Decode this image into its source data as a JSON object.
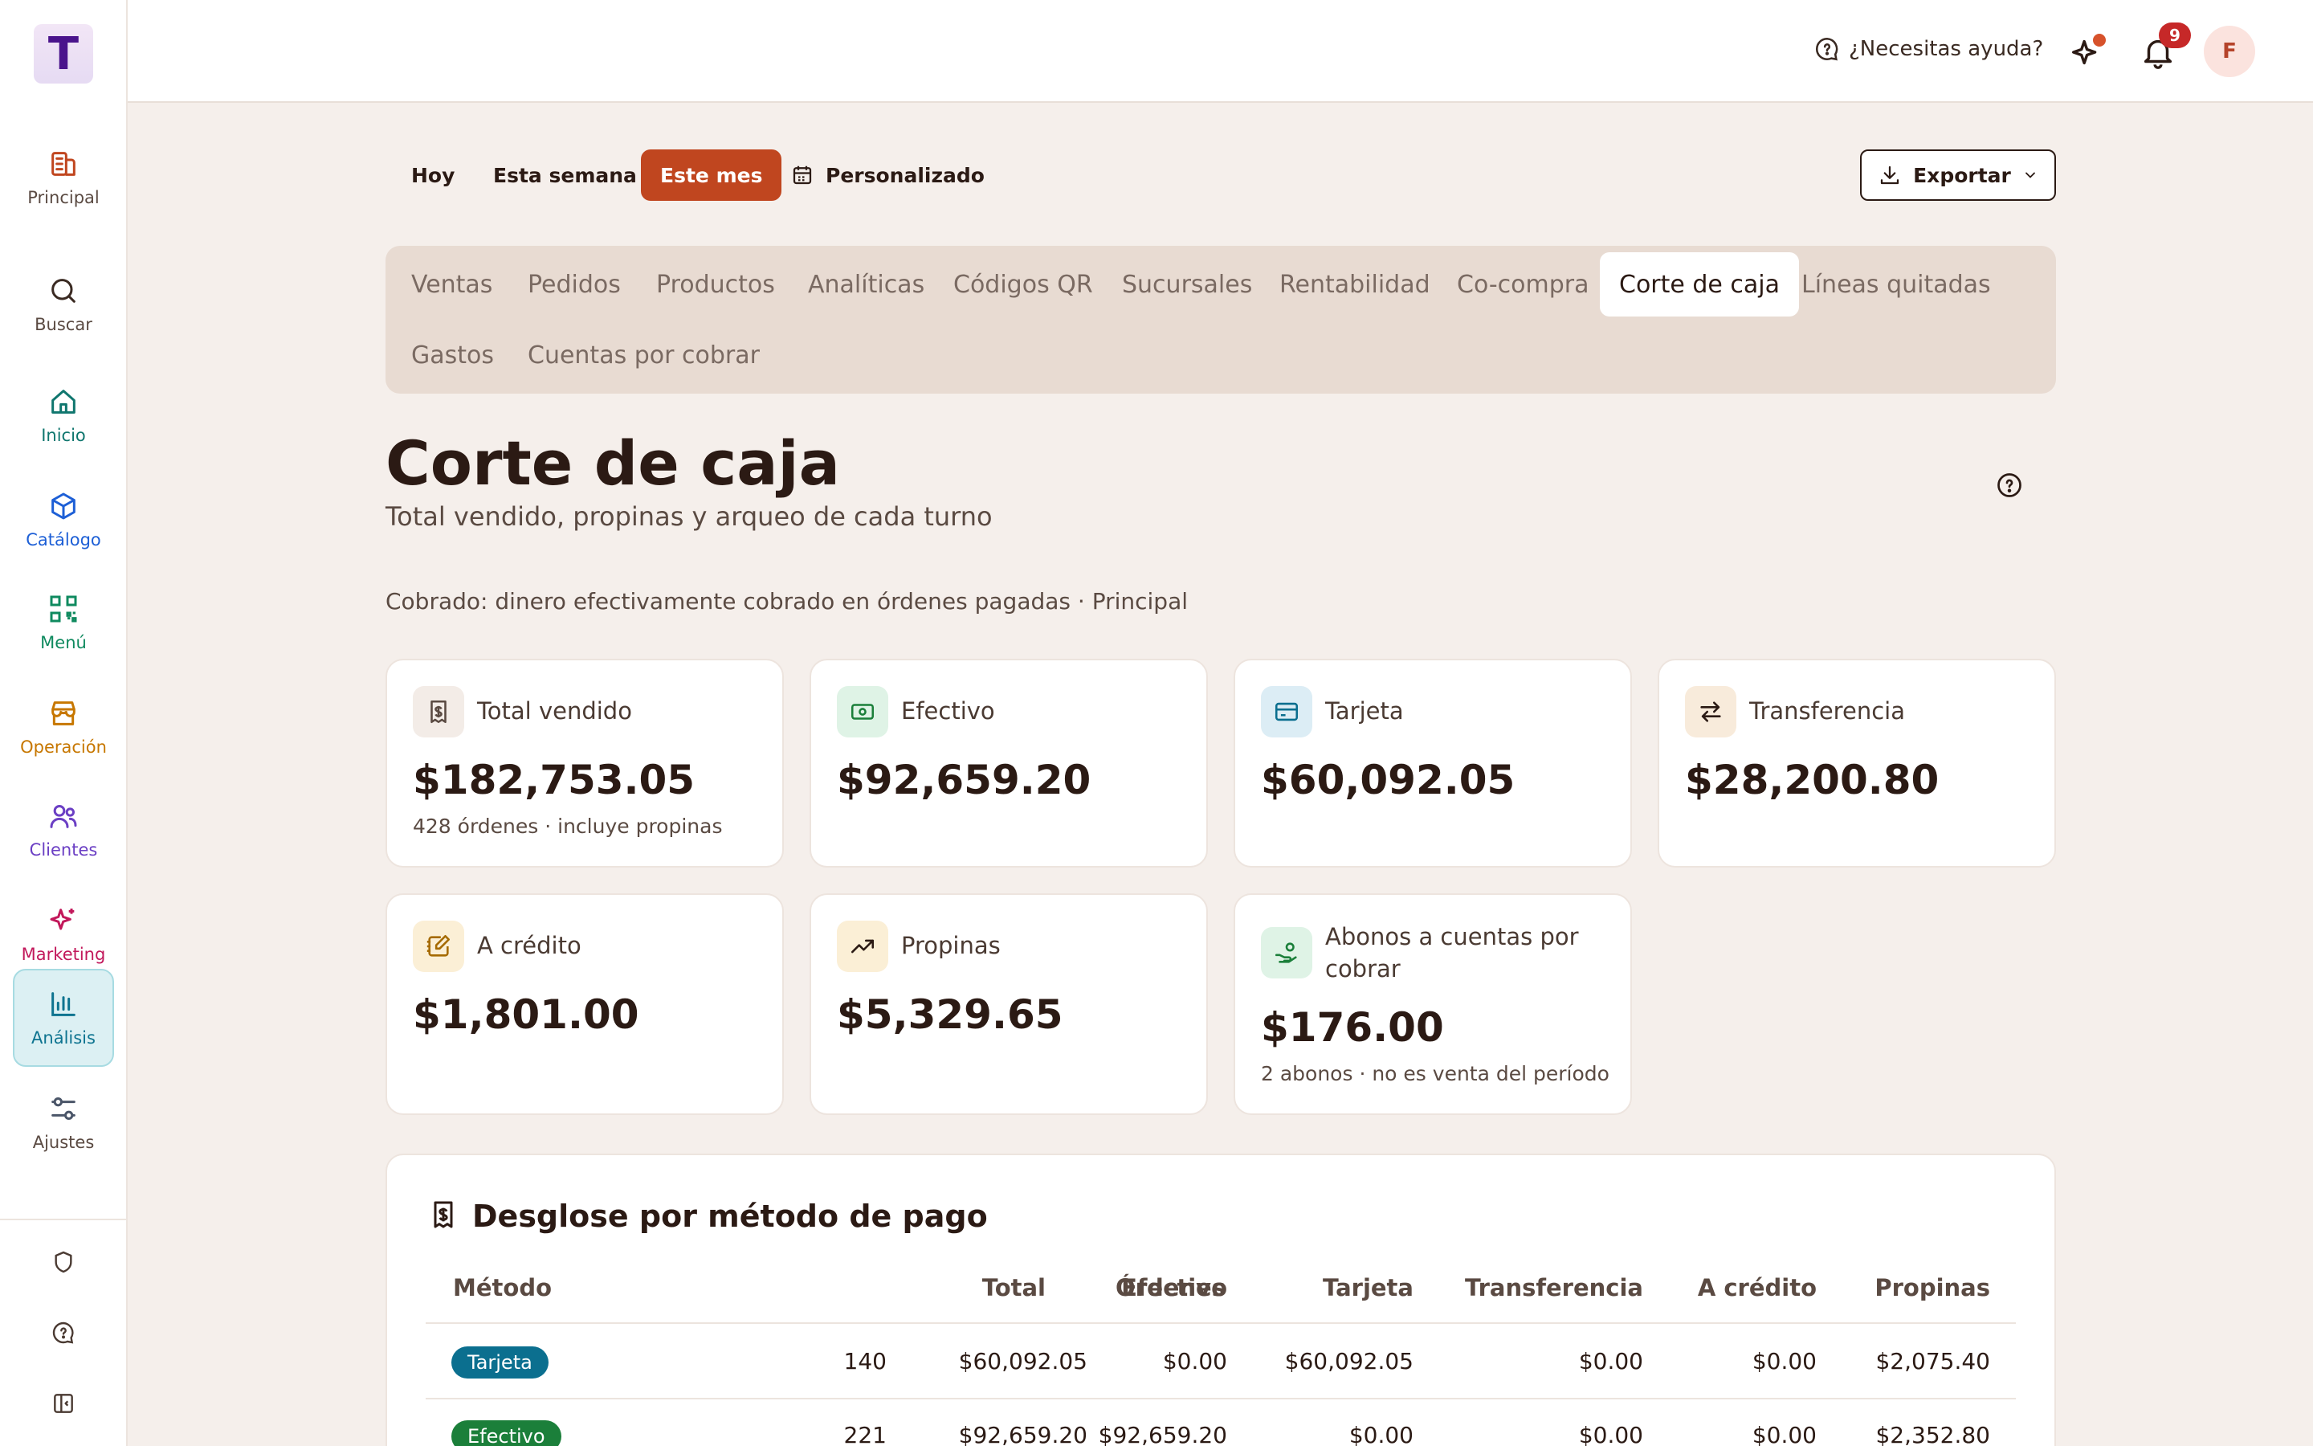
{
  "app": {
    "logo_letter": "T",
    "nav": [
      {
        "label": "Principal",
        "icon": "building-icon",
        "color": "#c0461f"
      },
      {
        "label": "Buscar",
        "icon": "search-icon",
        "color": "#3a2a22"
      },
      {
        "label": "Inicio",
        "icon": "home-icon",
        "color": "#0f766e"
      },
      {
        "label": "Catálogo",
        "icon": "box-icon",
        "color": "#1d5fd6"
      },
      {
        "label": "Menú",
        "icon": "qr-icon",
        "color": "#0f8a5f"
      },
      {
        "label": "Operación",
        "icon": "store-icon",
        "color": "#c77700"
      },
      {
        "label": "Clientes",
        "icon": "users-icon",
        "color": "#6b3fc4"
      },
      {
        "label": "Marketing",
        "icon": "sparkles-icon",
        "color": "#c2185b"
      },
      {
        "label": "Análisis",
        "icon": "bar-chart-icon",
        "color": "#0e7490"
      },
      {
        "label": "Ajustes",
        "icon": "sliders-icon",
        "color": "#4a5568"
      }
    ]
  },
  "topbar": {
    "help_label": "¿Necesitas ayuda?",
    "notifications_count": "9",
    "avatar_letter": "F"
  },
  "periods": {
    "today": "Hoy",
    "week": "Esta semana",
    "month": "Este mes",
    "custom": "Personalizado",
    "selected": "Este mes"
  },
  "export_label": "Exportar",
  "tabs": [
    "Ventas",
    "Pedidos",
    "Productos",
    "Analíticas",
    "Códigos QR",
    "Sucursales",
    "Rentabilidad",
    "Co-compra",
    "Corte de caja",
    "Líneas quitadas",
    "Gastos",
    "Cuentas por cobrar"
  ],
  "active_tab": "Corte de caja",
  "page": {
    "title": "Corte de caja",
    "subtitle": "Total vendido, propinas y arqueo de cada turno",
    "note": "Cobrado: dinero efectivamente cobrado en órdenes pagadas · Principal"
  },
  "cards": {
    "total": {
      "title": "Total vendido",
      "value": "$182,753.05",
      "caption": "428 órdenes · incluye propinas"
    },
    "cash": {
      "title": "Efectivo",
      "value": "$92,659.20"
    },
    "card": {
      "title": "Tarjeta",
      "value": "$60,092.05"
    },
    "transfer": {
      "title": "Transferencia",
      "value": "$28,200.80"
    },
    "credit": {
      "title": "A crédito",
      "value": "$1,801.00"
    },
    "tips": {
      "title": "Propinas",
      "value": "$5,329.65"
    },
    "payments": {
      "title": "Abonos a cuentas por cobrar",
      "value": "$176.00",
      "caption": "2 abonos · no es venta del período"
    }
  },
  "breakdown": {
    "title": "Desglose por método de pago",
    "columns": [
      "Método",
      "Órdenes",
      "Total",
      "Efectivo",
      "Tarjeta",
      "Transferencia",
      "A crédito",
      "Propinas"
    ],
    "rows": [
      {
        "method": "Tarjeta",
        "color": "#0b6f8f",
        "orders": "140",
        "total": "$60,092.05",
        "cash": "$0.00",
        "card": "$60,092.05",
        "transfer": "$0.00",
        "credit": "$0.00",
        "tips": "$2,075.40"
      },
      {
        "method": "Efectivo",
        "color": "#1b7f3a",
        "orders": "221",
        "total": "$92,659.20",
        "cash": "$92,659.20",
        "card": "$0.00",
        "transfer": "$0.00",
        "credit": "$0.00",
        "tips": "$2,352.80"
      }
    ]
  },
  "colors": {
    "accent": "#c0461f",
    "background": "#f5efeb",
    "tabs_panel": "#e8dbd2"
  }
}
